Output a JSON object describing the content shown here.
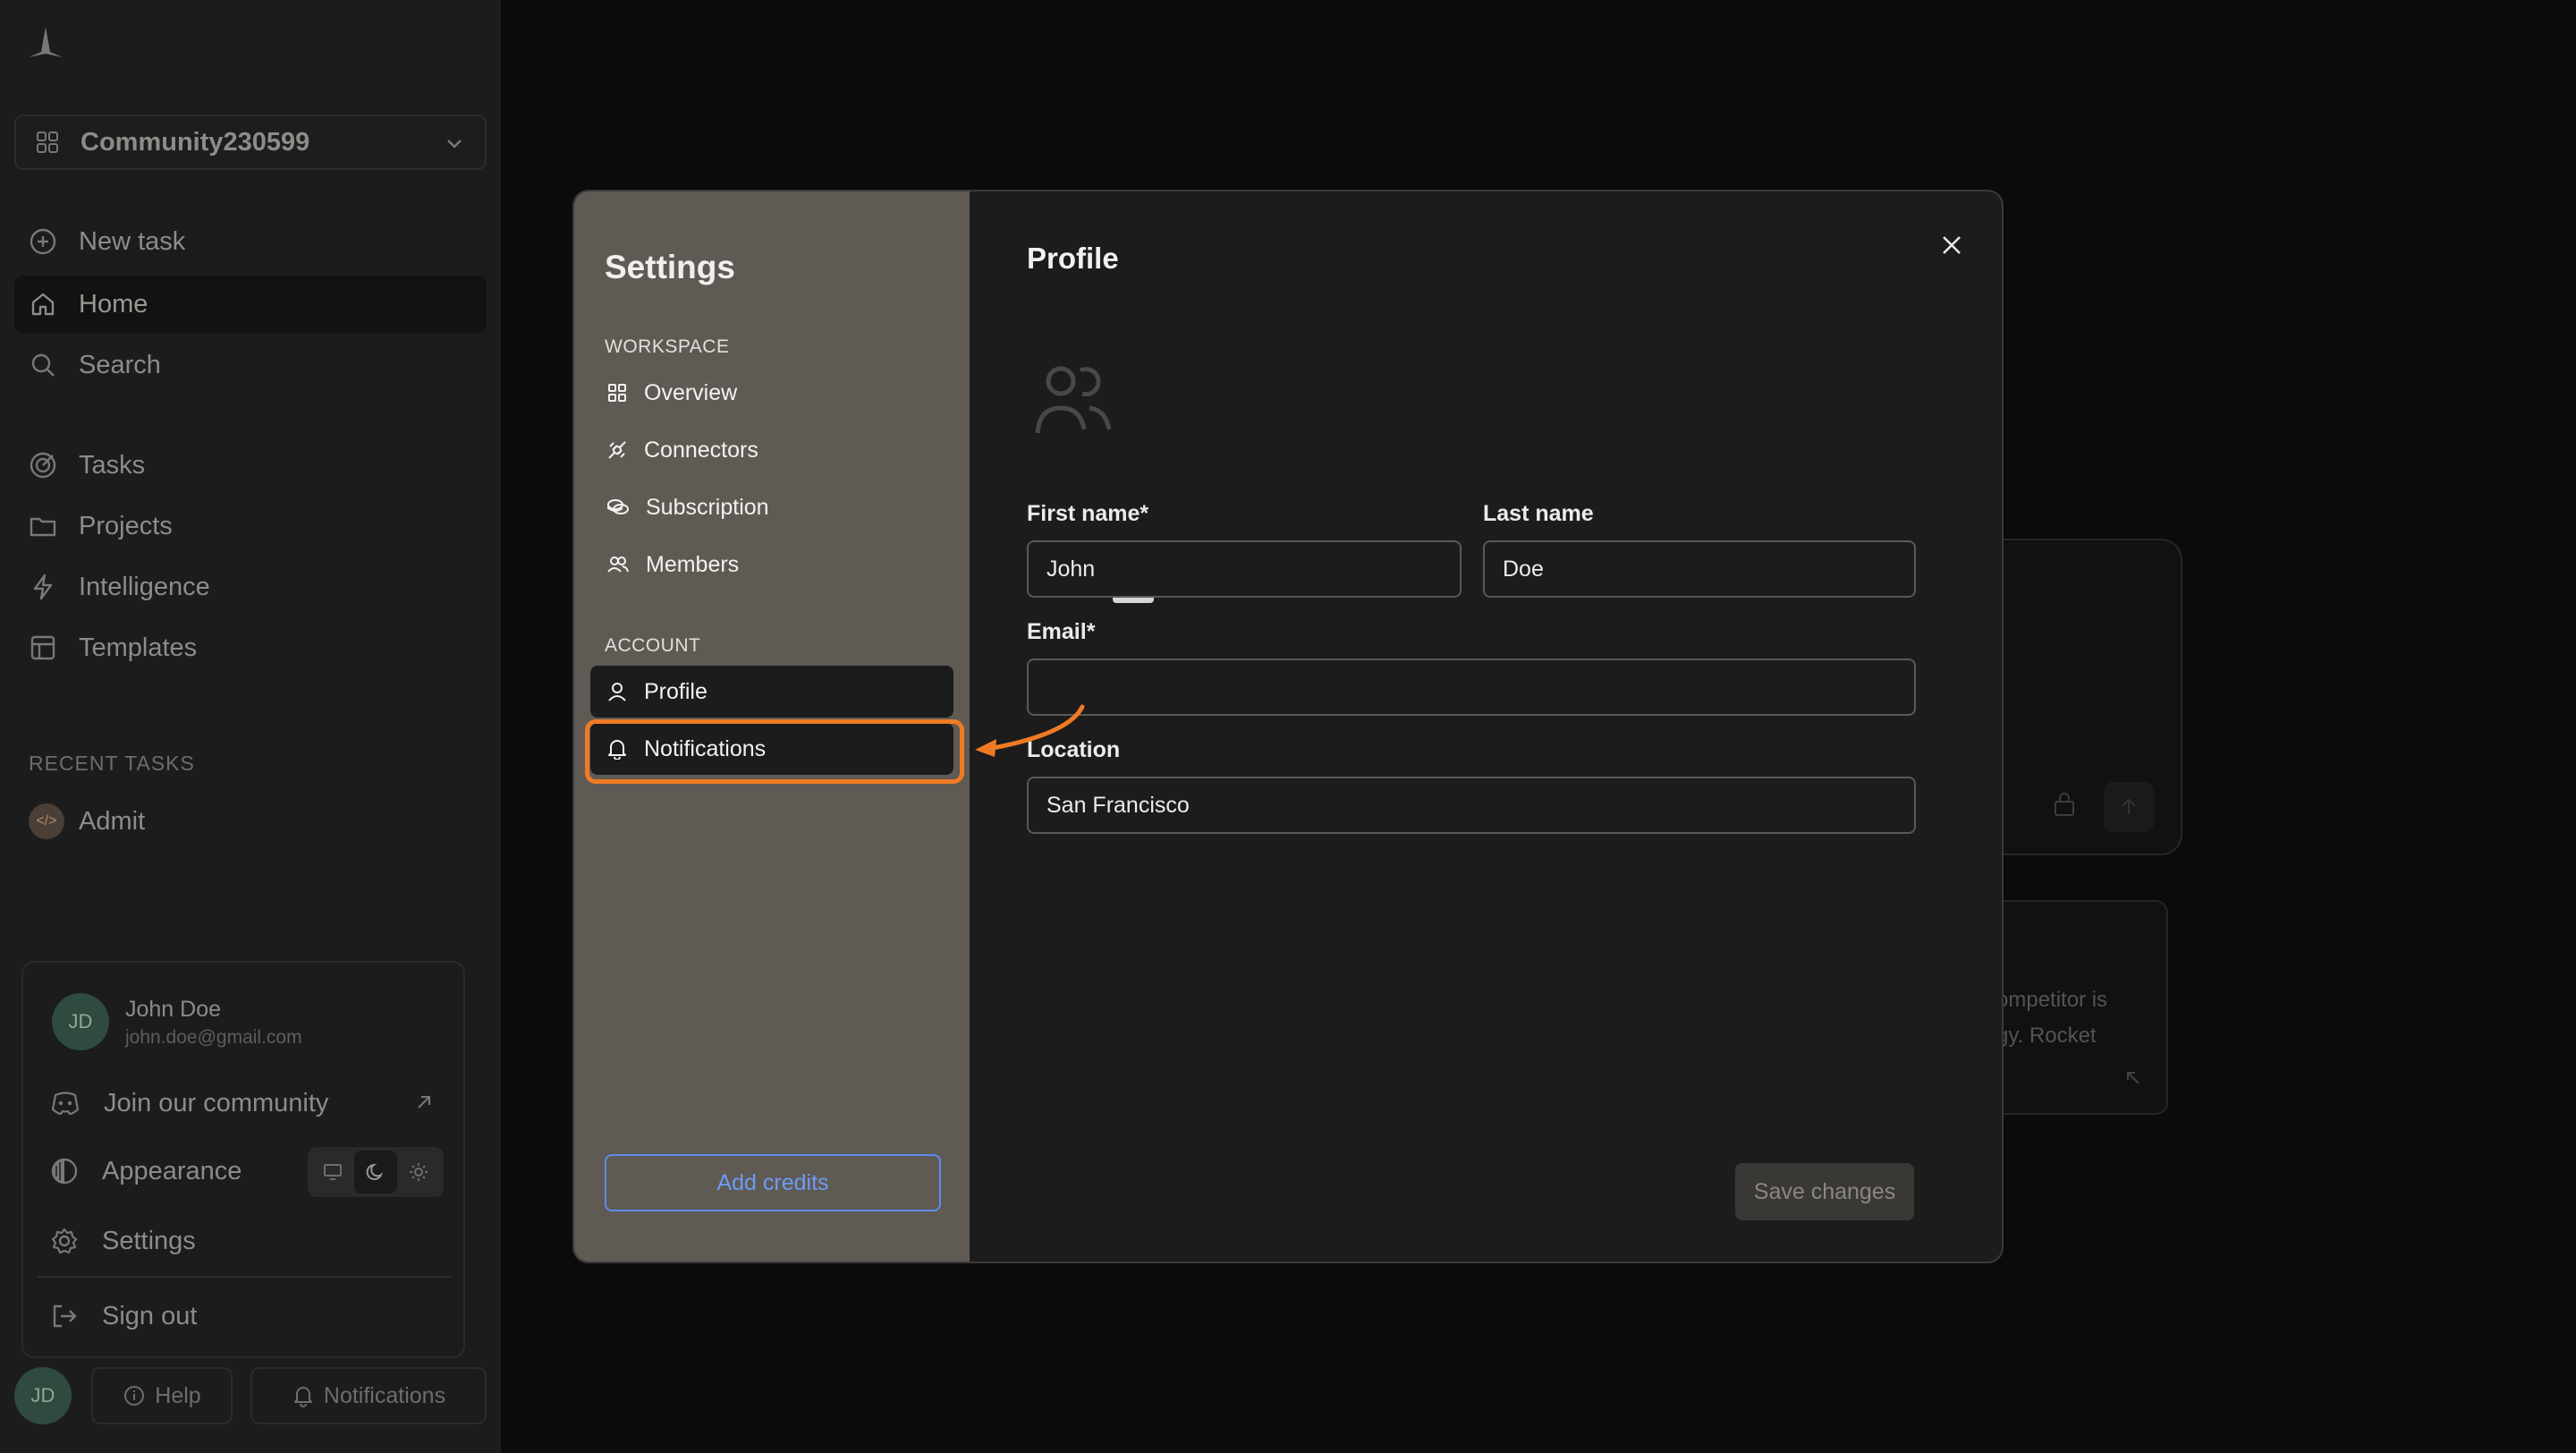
{
  "sidebar": {
    "workspace_name": "Community230599",
    "nav": [
      {
        "label": "New task",
        "icon": "plus-circle-icon"
      },
      {
        "label": "Home",
        "icon": "home-icon"
      },
      {
        "label": "Search",
        "icon": "search-icon"
      },
      {
        "label": "Tasks",
        "icon": "target-icon"
      },
      {
        "label": "Projects",
        "icon": "folder-icon"
      },
      {
        "label": "Intelligence",
        "icon": "bolt-icon"
      },
      {
        "label": "Templates",
        "icon": "template-icon"
      }
    ],
    "recent_tasks_label": "RECENT TASKS",
    "recent_tasks": [
      {
        "label": "Admit",
        "icon": "code-icon"
      }
    ],
    "user": {
      "initials": "JD",
      "name": "John Doe",
      "email": "john.doe@gmail.com"
    },
    "menu": {
      "community": "Join our community",
      "appearance": "Appearance",
      "settings": "Settings",
      "sign_out": "Sign out"
    },
    "bottom": {
      "initials": "JD",
      "help": "Help",
      "notifications": "Notifications"
    }
  },
  "background": {
    "card_text_line1": "ompetitor is",
    "card_text_line2": "gy. Rocket"
  },
  "modal": {
    "title": "Settings",
    "workspace_label": "WORKSPACE",
    "workspace_items": [
      {
        "label": "Overview",
        "icon": "grid-icon"
      },
      {
        "label": "Connectors",
        "icon": "plug-icon"
      },
      {
        "label": "Subscription",
        "icon": "coins-icon"
      },
      {
        "label": "Members",
        "icon": "users-icon"
      }
    ],
    "account_label": "ACCOUNT",
    "account_items": [
      {
        "label": "Profile",
        "icon": "user-icon"
      },
      {
        "label": "Notifications",
        "icon": "bell-icon"
      }
    ],
    "add_credits": "Add credits",
    "profile": {
      "title": "Profile",
      "first_name_label": "First name*",
      "first_name_value": "John",
      "last_name_label": "Last name",
      "last_name_value": "Doe",
      "email_label": "Email*",
      "email_value": "",
      "location_label": "Location",
      "location_value": "San Francisco",
      "save_label": "Save changes"
    }
  },
  "colors": {
    "highlight": "#f07a24",
    "accent_blue": "#5d8df0",
    "nav_panel": "#5f5a54"
  }
}
